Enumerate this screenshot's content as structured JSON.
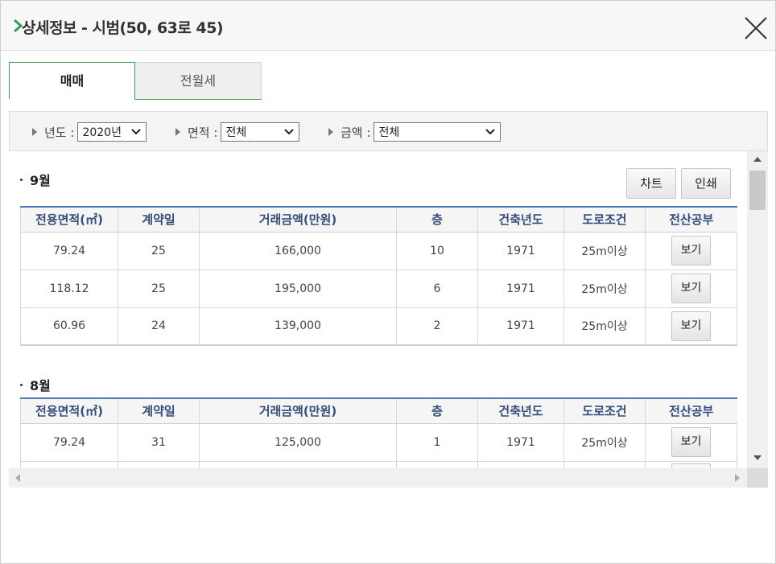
{
  "window": {
    "title": "상세정보 - 시범(50, 63로 45)",
    "accent_color": "#3a9a5a",
    "header_color": "#4a78b5"
  },
  "tabs": [
    {
      "label": "매매",
      "active": true
    },
    {
      "label": "전월세",
      "active": false
    }
  ],
  "filters": {
    "year": {
      "label": "년도 :",
      "value": "2020년"
    },
    "area": {
      "label": "면적 :",
      "value": "전체"
    },
    "amount": {
      "label": "금액 :",
      "value": "전체"
    }
  },
  "actions": {
    "chart_label": "차트",
    "print_label": "인쇄"
  },
  "columns": [
    "전용면적(㎡)",
    "계약일",
    "거래금액(만원)",
    "층",
    "건축년도",
    "도로조건",
    "전산공부"
  ],
  "months": [
    {
      "title": "9월",
      "rows": [
        {
          "area": "79.24",
          "day": "25",
          "price": "166,000",
          "floor": "10",
          "built": "1971",
          "road": "25m이상",
          "action": "보기"
        },
        {
          "area": "118.12",
          "day": "25",
          "price": "195,000",
          "floor": "6",
          "built": "1971",
          "road": "25m이상",
          "action": "보기"
        },
        {
          "area": "60.96",
          "day": "24",
          "price": "139,000",
          "floor": "2",
          "built": "1971",
          "road": "25m이상",
          "action": "보기"
        }
      ]
    },
    {
      "title": "8월",
      "rows": [
        {
          "area": "79.24",
          "day": "31",
          "price": "125,000",
          "floor": "1",
          "built": "1971",
          "road": "25m이상",
          "action": "보기"
        },
        {
          "area": "",
          "day": "",
          "price": "",
          "floor": "",
          "built": "",
          "road": "",
          "action": ""
        }
      ]
    }
  ]
}
